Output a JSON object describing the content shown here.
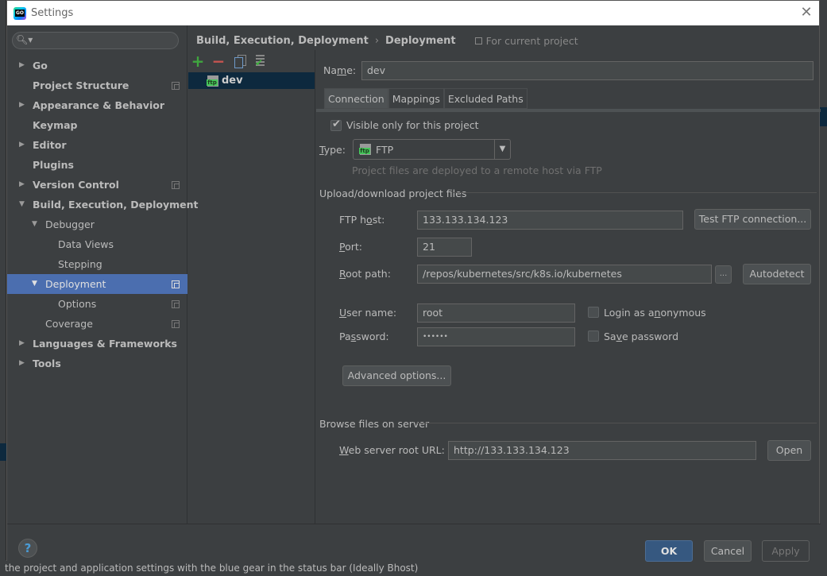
{
  "window": {
    "title": "Settings",
    "close_label": "✕"
  },
  "background": {
    "status_text": "the project and application settings with the blue gear in the status bar (Ideally Bhost)"
  },
  "sidebar": {
    "search_placeholder": "",
    "search_icon": "search-icon",
    "items": [
      {
        "label": "Go",
        "arrow": "▶"
      },
      {
        "label": "Project Structure",
        "arrow": ""
      },
      {
        "label": "Appearance & Behavior",
        "arrow": "▶"
      },
      {
        "label": "Keymap",
        "arrow": ""
      },
      {
        "label": "Editor",
        "arrow": "▶"
      },
      {
        "label": "Plugins",
        "arrow": ""
      },
      {
        "label": "Version Control",
        "arrow": "▶"
      },
      {
        "label": "Build, Execution, Deployment",
        "arrow": "▼"
      },
      {
        "label": "Debugger",
        "arrow": "▼"
      },
      {
        "label": "Data Views",
        "arrow": ""
      },
      {
        "label": "Stepping",
        "arrow": ""
      },
      {
        "label": "Deployment",
        "arrow": "▼"
      },
      {
        "label": "Options",
        "arrow": ""
      },
      {
        "label": "Coverage",
        "arrow": ""
      },
      {
        "label": "Languages & Frameworks",
        "arrow": "▶"
      },
      {
        "label": "Tools",
        "arrow": "▶"
      }
    ]
  },
  "breadcrumb": {
    "parts": [
      "Build, Execution, Deployment",
      "Deployment"
    ],
    "separator": "›",
    "scope": "For current project"
  },
  "server_list": {
    "toolbar": {
      "add": "+",
      "remove": "−"
    },
    "servers": [
      {
        "name": "dev",
        "type_badge": "ftp"
      }
    ]
  },
  "detail": {
    "name_label": {
      "pre": "Na",
      "u": "m",
      "post": "e:"
    },
    "name_value": "dev",
    "tabs": [
      "Connection",
      "Mappings",
      "Excluded Paths"
    ],
    "visible_only_label": "Visible only for this project",
    "visible_only_checked": true,
    "type_label": {
      "u": "T",
      "post": "ype:"
    },
    "type_value": "FTP",
    "type_hint": "Project files are deployed to a remote host via FTP",
    "upload_group": "Upload/download project files",
    "ftp_host_label": {
      "pre": "FTP h",
      "u": "o",
      "post": "st:"
    },
    "ftp_host_value": "133.133.134.123",
    "test_button": "Test FTP connection...",
    "port_label": {
      "u": "P",
      "post": "ort:"
    },
    "port_value": "21",
    "root_label": {
      "u": "R",
      "post": "oot path:"
    },
    "root_value": "/repos/kubernetes/src/k8s.io/kubernetes",
    "browse_button": "...",
    "autodetect_button": "Autodetect",
    "user_label": {
      "u": "U",
      "post": "ser name:"
    },
    "user_value": "root",
    "anon_label": {
      "pre": "Login as a",
      "u": "n",
      "post": "onymous"
    },
    "anon_checked": false,
    "password_label": {
      "pre": "Pa",
      "u": "s",
      "post": "sword:"
    },
    "password_value": "••••••",
    "save_pw_label": {
      "pre": "Sa",
      "u": "v",
      "post": "e password"
    },
    "save_pw_checked": false,
    "advanced_button": "Advanced options...",
    "browse_group": "Browse files on server",
    "web_url_label": {
      "u": "W",
      "post": "eb server root URL:"
    },
    "web_url_value": "http://133.133.134.123",
    "open_button": "Open"
  },
  "footer": {
    "help": "?",
    "ok": "OK",
    "cancel": "Cancel",
    "apply": "Apply"
  }
}
